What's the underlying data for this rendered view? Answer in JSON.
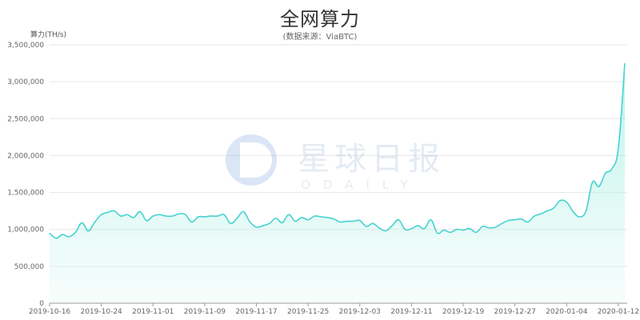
{
  "chart_data": {
    "type": "area",
    "title": "全网算力",
    "subtitle": "(数据来源：ViaBTC)",
    "ylabel": "算力(TH/s)",
    "xlabel": "",
    "ylim": [
      0,
      3500000
    ],
    "yticks": [
      "0",
      "500,000",
      "1,000,000",
      "1,500,000",
      "2,000,000",
      "2,500,000",
      "3,000,000",
      "3,500,000"
    ],
    "xticks": [
      "2019-10-16",
      "2019-10-24",
      "2019-11-01",
      "2019-11-09",
      "2019-11-17",
      "2019-11-25",
      "2019-12-03",
      "2019-12-11",
      "2019-12-19",
      "2019-12-27",
      "2020-01-04",
      "2020-01-12"
    ],
    "grid": true,
    "legend": "none",
    "line_color": "#44d3d0",
    "fill_color": "#aef0e5",
    "watermark": {
      "cn": "星球日报",
      "en": "ODAILY"
    },
    "x": [
      "2019-10-16",
      "2019-10-17",
      "2019-10-18",
      "2019-10-19",
      "2019-10-20",
      "2019-10-21",
      "2019-10-22",
      "2019-10-23",
      "2019-10-24",
      "2019-10-25",
      "2019-10-26",
      "2019-10-27",
      "2019-10-28",
      "2019-10-29",
      "2019-10-30",
      "2019-10-31",
      "2019-11-01",
      "2019-11-02",
      "2019-11-03",
      "2019-11-04",
      "2019-11-05",
      "2019-11-06",
      "2019-11-07",
      "2019-11-08",
      "2019-11-09",
      "2019-11-10",
      "2019-11-11",
      "2019-11-12",
      "2019-11-13",
      "2019-11-14",
      "2019-11-15",
      "2019-11-16",
      "2019-11-17",
      "2019-11-18",
      "2019-11-19",
      "2019-11-20",
      "2019-11-21",
      "2019-11-22",
      "2019-11-23",
      "2019-11-24",
      "2019-11-25",
      "2019-11-26",
      "2019-11-27",
      "2019-11-28",
      "2019-11-29",
      "2019-11-30",
      "2019-12-01",
      "2019-12-02",
      "2019-12-03",
      "2019-12-04",
      "2019-12-05",
      "2019-12-06",
      "2019-12-07",
      "2019-12-08",
      "2019-12-09",
      "2019-12-10",
      "2019-12-11",
      "2019-12-12",
      "2019-12-13",
      "2019-12-14",
      "2019-12-15",
      "2019-12-16",
      "2019-12-17",
      "2019-12-18",
      "2019-12-19",
      "2019-12-20",
      "2019-12-21",
      "2019-12-22",
      "2019-12-23",
      "2019-12-24",
      "2019-12-25",
      "2019-12-26",
      "2019-12-27",
      "2019-12-28",
      "2019-12-29",
      "2019-12-30",
      "2019-12-31",
      "2020-01-01",
      "2020-01-02",
      "2020-01-03",
      "2020-01-04",
      "2020-01-05",
      "2020-01-06",
      "2020-01-07",
      "2020-01-08",
      "2020-01-09",
      "2020-01-10",
      "2020-01-11",
      "2020-01-12",
      "2020-01-13"
    ],
    "values": [
      950000,
      880000,
      930000,
      900000,
      960000,
      1090000,
      980000,
      1100000,
      1200000,
      1230000,
      1250000,
      1180000,
      1200000,
      1160000,
      1240000,
      1120000,
      1180000,
      1200000,
      1180000,
      1180000,
      1210000,
      1200000,
      1100000,
      1170000,
      1170000,
      1180000,
      1180000,
      1200000,
      1080000,
      1150000,
      1240000,
      1100000,
      1030000,
      1050000,
      1080000,
      1150000,
      1090000,
      1200000,
      1110000,
      1160000,
      1130000,
      1180000,
      1170000,
      1160000,
      1140000,
      1100000,
      1110000,
      1110000,
      1120000,
      1040000,
      1080000,
      1020000,
      980000,
      1050000,
      1130000,
      1000000,
      1010000,
      1050000,
      1010000,
      1130000,
      950000,
      990000,
      960000,
      1000000,
      990000,
      1010000,
      960000,
      1040000,
      1020000,
      1030000,
      1080000,
      1120000,
      1130000,
      1140000,
      1100000,
      1180000,
      1210000,
      1250000,
      1290000,
      1390000,
      1370000,
      1240000,
      1170000,
      1250000,
      1640000,
      1580000,
      1760000,
      1820000,
      2100000,
      3250000
    ]
  }
}
